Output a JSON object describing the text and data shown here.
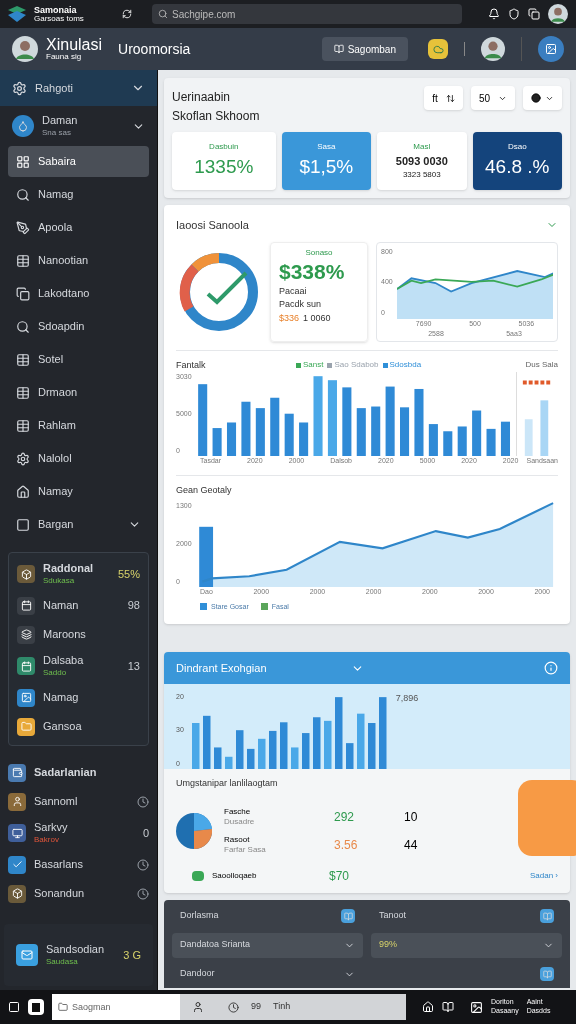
{
  "topbar": {
    "brand": "Samonaia",
    "brand_sub": "Garsoas toms",
    "search": {
      "placeholder": "Sachgipe.com"
    }
  },
  "header": {
    "title": "Xinulasi",
    "subtitle": "Fauna sig",
    "section": "Uroomorsia",
    "button": "Sagomban"
  },
  "sidebar": {
    "group": {
      "label": "Rahgoti",
      "expanded": true
    },
    "account": {
      "name": "Daman",
      "sub": "Sna sas"
    },
    "items": [
      {
        "label": "Sabaira",
        "selected": true,
        "kind": "link"
      },
      {
        "label": "Namag",
        "selected": false,
        "kind": "link"
      },
      {
        "label": "Apoola",
        "selected": false,
        "kind": "link"
      },
      {
        "label": "Nanootian",
        "selected": false,
        "kind": "link"
      },
      {
        "label": "Lakodtano",
        "selected": false,
        "kind": "link"
      },
      {
        "label": "Sdoapdin",
        "selected": false,
        "kind": "link"
      },
      {
        "label": "Sotel",
        "selected": false,
        "kind": "link"
      },
      {
        "label": "Drmaon",
        "selected": false,
        "kind": "link"
      },
      {
        "label": "Rahlam",
        "selected": false,
        "kind": "link"
      },
      {
        "label": "Nalolol",
        "selected": false,
        "kind": "link"
      },
      {
        "label": "Namay",
        "selected": false,
        "kind": "link"
      },
      {
        "label": "Bargan",
        "selected": false,
        "kind": "group"
      }
    ],
    "card": [
      {
        "label": "Raddonal",
        "sub": "Sdukasa",
        "value": "55%"
      },
      {
        "label": "Naman",
        "value": "98"
      },
      {
        "label": "Maroons"
      },
      {
        "label": "Dalsaba",
        "sub": "Saddo",
        "value": "13"
      },
      {
        "label": "Namag"
      },
      {
        "label": "Gansoa"
      }
    ],
    "section": [
      {
        "label": "Sadarlanian"
      },
      {
        "label": "Sannoml"
      },
      {
        "label": "Sarkvy",
        "sub": "Bakrov",
        "value": "0"
      },
      {
        "label": "Basarlans"
      },
      {
        "label": "Sonandun"
      }
    ],
    "footer": {
      "label": "Sandsodian",
      "sub": "Saudasa",
      "value": "3 G"
    }
  },
  "overview": {
    "title": "Uerinaabin",
    "subtitle": "Skoflan Skhoom",
    "controls": [
      "ft",
      "50"
    ],
    "stats": [
      {
        "label": "Dasbuin",
        "value": "1335%",
        "kind": "light"
      },
      {
        "label": "Sasa",
        "value": "$1,5%",
        "kind": "blue"
      },
      {
        "label": "Masl",
        "value": "5093 0030",
        "sub": "3323 5803",
        "kind": "plain"
      },
      {
        "label": "Dsao",
        "value": "46.8 .%",
        "kind": "navy"
      }
    ]
  },
  "summary": {
    "title": "Iaoosi Sanoola",
    "highlight": {
      "label": "Sonaso",
      "value": "$338%",
      "line1": "Pacaai",
      "line2": "Pacdk sun",
      "delta": "$336",
      "delta_note": "1 0060"
    },
    "trend": {
      "yticks": [
        "800",
        "400",
        "0"
      ],
      "xlabels": [
        "7690",
        "500",
        "5036"
      ],
      "xsub": [
        "2588",
        "5aa3"
      ]
    }
  },
  "bars": {
    "title": "Fantalk",
    "legend": [
      {
        "label": "Sanst",
        "color": "#3aa856"
      },
      {
        "label": "Sao Sdabob",
        "color": "#9aa3ad"
      },
      {
        "label": "Sdosbda",
        "color": "#2f8fd8"
      }
    ],
    "yticks": [
      "3030",
      "5000",
      "0"
    ],
    "xlabels": [
      "Tasdar",
      "2020",
      "2000",
      "Dalsob",
      "2020",
      "5000",
      "2020",
      "2020"
    ],
    "side_title": "Dus Sala",
    "side_label": "Sandsaan"
  },
  "growth": {
    "title": "Gean Geotaly",
    "yticks": [
      "1300",
      "2000",
      "0"
    ],
    "xlabels": [
      "Dao",
      "2000",
      "2000",
      "2000",
      "2000",
      "2000",
      "2000"
    ],
    "legend": [
      {
        "label": "Stare Gosar",
        "color": "#2f8fd8"
      },
      {
        "label": "Fasal",
        "color": "#5aa55a"
      }
    ]
  },
  "exchange": {
    "title": "Dindrant Exohgian",
    "yticks": [
      "20",
      "30",
      "0"
    ],
    "peak": "7,896",
    "breakdown_title": "Umgstanipar lanlilaogtam",
    "rows": [
      {
        "name": "Fasche",
        "sub": "Dusadre",
        "value": "292",
        "count": "10",
        "color": "#2e9a4e"
      },
      {
        "name": "Rasoot",
        "sub": "Farfar Sasa",
        "value": "3.56",
        "count": "44",
        "color": "#e8894a"
      }
    ],
    "footer": {
      "label": "Saoolloqaeb",
      "value": "$70",
      "link": "Sadan ›"
    }
  },
  "settings": [
    {
      "label": "Dorlasma",
      "kind": "action"
    },
    {
      "label": "Tanoot",
      "kind": "action"
    },
    {
      "label": "Dandatoa Srianta",
      "kind": "select"
    },
    {
      "label": "99%",
      "kind": "select"
    },
    {
      "label": "Dandoor",
      "kind": "expand"
    }
  ],
  "taskbar": {
    "search_placeholder": "Saogman",
    "count": "99",
    "label": "Tinh",
    "tray": [
      {
        "top": "Doriton",
        "bottom": "Dasaany"
      },
      {
        "top": "Aaint",
        "bottom": "Dasdds"
      }
    ]
  }
}
